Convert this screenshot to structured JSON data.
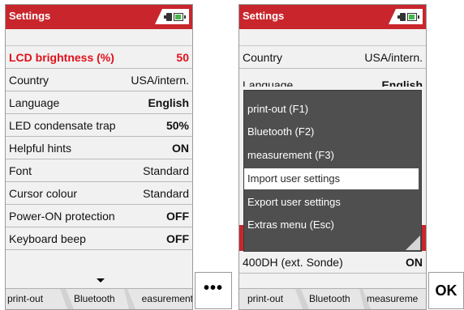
{
  "left_screen": {
    "title": "Settings",
    "rows": [
      {
        "label": "LCD brightness (%)",
        "value": "50",
        "active": true
      },
      {
        "label": "Country",
        "value": "USA/intern."
      },
      {
        "label": "Language",
        "value": "English"
      },
      {
        "label": "LED condensate trap",
        "value": "50%"
      },
      {
        "label": "Helpful hints",
        "value": "ON"
      },
      {
        "label": "Font",
        "value": "Standard"
      },
      {
        "label": "Cursor colour",
        "value": "Standard"
      },
      {
        "label": "Power-ON protection",
        "value": "OFF"
      },
      {
        "label": "Keyboard beep",
        "value": "OFF"
      }
    ],
    "softkeys": [
      "print-out",
      "Bluetooth",
      "easurement"
    ]
  },
  "right_screen": {
    "title": "Settings",
    "rows_top": [
      {
        "label": "Country",
        "value": "USA/intern."
      },
      {
        "label": "Language",
        "value": "English"
      }
    ],
    "row_bottom": {
      "label": "400DH (ext. Sonde)",
      "value": "ON"
    },
    "menu": [
      {
        "label": "print-out (F1)"
      },
      {
        "label": "Bluetooth (F2)"
      },
      {
        "label": "measurement (F3)"
      },
      {
        "label": "Import user settings",
        "selected": true
      },
      {
        "label": "Export user settings"
      },
      {
        "label": "Extras menu (Esc)"
      }
    ],
    "softkeys": [
      "print-out",
      "Bluetooth",
      "measureme"
    ]
  },
  "buttons": {
    "more": "•••",
    "ok": "OK"
  },
  "colors": {
    "title_bar": "#c8262c",
    "active_text": "#e0101a",
    "popup_bg": "#4f4f4f",
    "battery": "#44b848"
  },
  "icons": [
    "plug-icon",
    "battery-icon",
    "scroll-down-arrow-icon"
  ]
}
